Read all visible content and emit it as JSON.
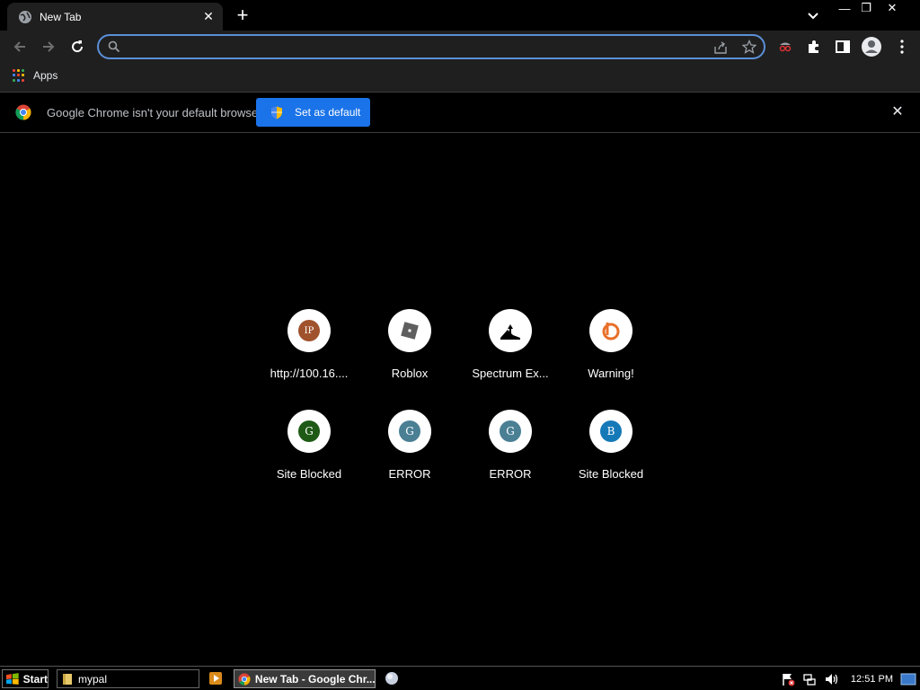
{
  "tab": {
    "title": "New Tab",
    "close_icon": "close-icon"
  },
  "window": {
    "minimize": "—",
    "restore": "❐",
    "close": "✕"
  },
  "toolbar": {
    "omnibox_value": "",
    "omnibox_placeholder": ""
  },
  "bookmarks": {
    "apps_label": "Apps"
  },
  "infobar": {
    "message": "Google Chrome isn't your default browser",
    "button_label": "Set as default"
  },
  "shortcuts": [
    {
      "label": "http://100.16....",
      "icon_text": "IP",
      "icon_color": "#a0522d"
    },
    {
      "label": "Roblox",
      "icon_text": "",
      "icon_color": "#5f5f5f"
    },
    {
      "label": "Spectrum Ex...",
      "icon_text": "",
      "icon_color": "#000000"
    },
    {
      "label": "Warning!",
      "icon_text": "b",
      "icon_color": "#e8702a"
    },
    {
      "label": "Site Blocked",
      "icon_text": "G",
      "icon_color": "#1e5a16"
    },
    {
      "label": "ERROR",
      "icon_text": "G",
      "icon_color": "#4a7f94"
    },
    {
      "label": "ERROR",
      "icon_text": "G",
      "icon_color": "#4a7f94"
    },
    {
      "label": "Site Blocked",
      "icon_text": "B",
      "icon_color": "#1579b8"
    }
  ],
  "taskbar": {
    "start_label": "Start",
    "items": [
      {
        "label": "mypal"
      },
      {
        "label": "New Tab - Google Chr..."
      }
    ],
    "clock": "12:51 PM"
  },
  "colors": {
    "accent": "#1a73e8",
    "omnibox_border": "#5b8fd8"
  }
}
